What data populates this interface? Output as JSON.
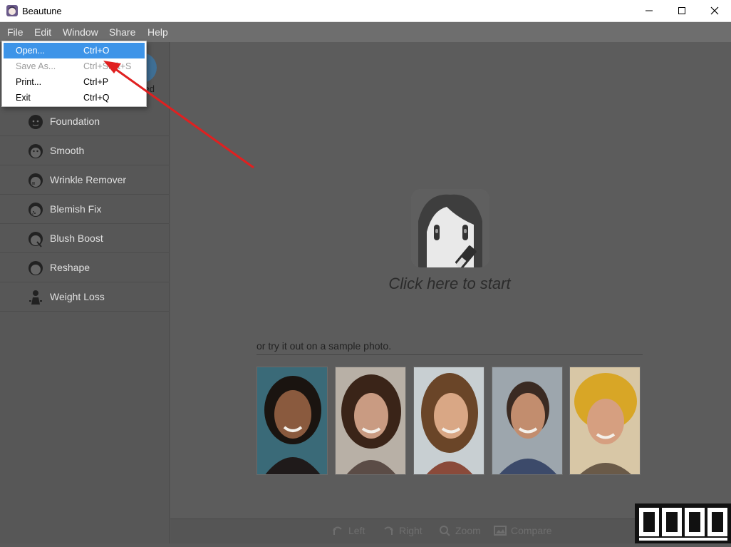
{
  "window": {
    "title": "Beautune"
  },
  "menubar": {
    "items": [
      "File",
      "Edit",
      "Window",
      "Share",
      "Help"
    ]
  },
  "file_menu": [
    {
      "label": "Open...",
      "shortcut": "Ctrl+O",
      "state": "highlighted"
    },
    {
      "label": "Save As...",
      "shortcut": "Ctrl+Shift+S",
      "state": "disabled"
    },
    {
      "label": "Print...",
      "shortcut": "Ctrl+P",
      "state": "normal"
    },
    {
      "label": "Exit",
      "shortcut": "Ctrl+Q",
      "state": "normal"
    }
  ],
  "sidebar": {
    "mode_label": "ced",
    "tools": [
      {
        "label": "Foundation",
        "icon": "face-foundation-icon"
      },
      {
        "label": "Smooth",
        "icon": "face-smooth-icon"
      },
      {
        "label": "Wrinkle Remover",
        "icon": "face-wrinkle-icon"
      },
      {
        "label": "Blemish Fix",
        "icon": "face-blemish-icon"
      },
      {
        "label": "Blush Boost",
        "icon": "face-blush-icon"
      },
      {
        "label": "Reshape",
        "icon": "face-reshape-icon"
      },
      {
        "label": "Weight Loss",
        "icon": "weight-loss-icon"
      }
    ]
  },
  "main": {
    "start_text": "Click here to start",
    "sample_label": "or try it out on a sample photo.",
    "sample_photos": [
      "sample-photo-1",
      "sample-photo-2",
      "sample-photo-3",
      "sample-photo-4",
      "sample-photo-5"
    ]
  },
  "bottombar": {
    "items": [
      {
        "label": "Left",
        "icon": "rotate-left-icon"
      },
      {
        "label": "Right",
        "icon": "rotate-right-icon"
      },
      {
        "label": "Zoom",
        "icon": "zoom-icon"
      },
      {
        "label": "Compare",
        "icon": "compare-icon"
      }
    ]
  },
  "colors": {
    "menu_highlight": "#3d94e8",
    "annotation_arrow": "#e02020",
    "sidebar_bg": "#575757",
    "main_bg": "#5c5c5c"
  }
}
